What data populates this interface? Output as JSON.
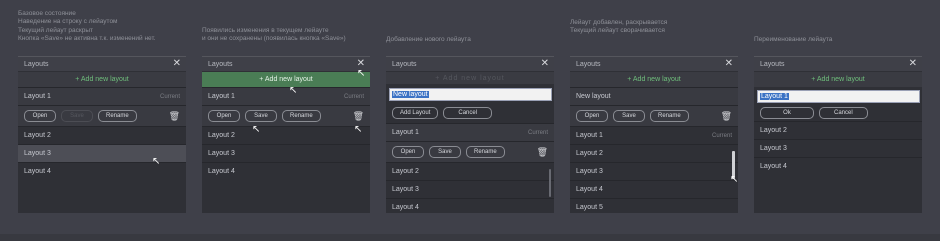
{
  "captions": [
    {
      "lines": [
        "Базовое состояние",
        "Наведение на строку с лейаутом",
        "Текущий лейаут раскрыт",
        "Кнопка «Save» не активна т.к. изменений нет."
      ]
    },
    {
      "lines": [
        "Появились изменения в текущем лейауте",
        "и они не сохранены (появилась кнопка «Save»)"
      ]
    },
    {
      "lines": [
        "Добавление нового лейаута"
      ]
    },
    {
      "lines": [
        "Лейаут добавлен, раскрывается",
        "Текущий лейаут сворачивается"
      ]
    },
    {
      "lines": [
        "Переименование лейаута"
      ]
    }
  ],
  "panel_title": "Layouts",
  "add_label": "+ Add new layout",
  "current_label": "Current",
  "buttons": {
    "open": "Open",
    "save": "Save",
    "rename": "Rename",
    "add_layout": "Add Layout",
    "cancel": "Cancel",
    "ok": "Ok"
  },
  "icons": {
    "close": "close-icon",
    "trash": "trash-icon",
    "cursor": "cursor-icon"
  },
  "panels": [
    {
      "layouts": [
        "Layout 1",
        "Layout 2",
        "Layout 3",
        "Layout 4"
      ]
    },
    {
      "layouts": [
        "Layout 1",
        "Layout 2",
        "Layout 3",
        "Layout 4"
      ]
    },
    {
      "input_value": "New layout",
      "add_placeholder": "+ Add new layout",
      "layouts": [
        "Layout 1",
        "Layout 2",
        "Layout 3",
        "Layout 4"
      ]
    },
    {
      "layouts": [
        "New layout",
        "Layout 1",
        "Layout 2",
        "Layout 3",
        "Layout 4",
        "Layout 5"
      ]
    },
    {
      "input_value": "Layout 1",
      "layouts": [
        "Layout 2",
        "Layout 3",
        "Layout 4"
      ]
    }
  ],
  "colors": {
    "background": "#3f4049",
    "panel": "#2f3036",
    "accent_green": "#6fbe7c",
    "selection_blue": "#3b72c4"
  }
}
